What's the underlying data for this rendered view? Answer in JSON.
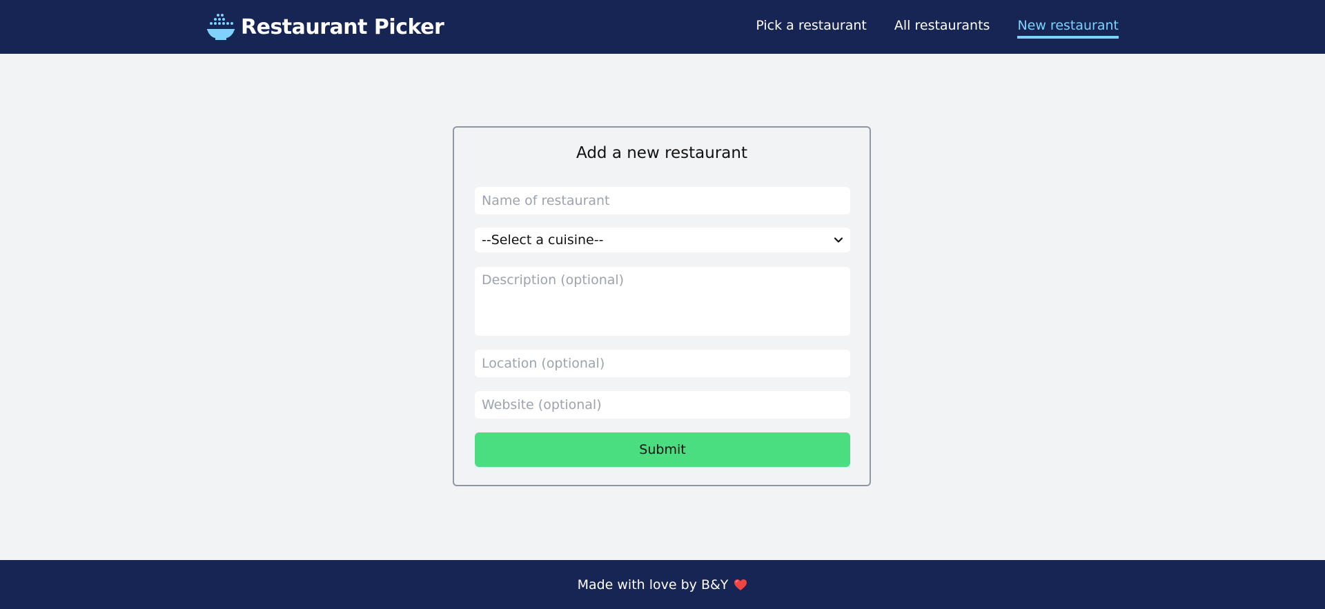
{
  "header": {
    "title": "Restaurant Picker",
    "logo_icon": "rice-bowl-icon",
    "nav": [
      {
        "label": "Pick a restaurant",
        "active": false
      },
      {
        "label": "All restaurants",
        "active": false
      },
      {
        "label": "New restaurant",
        "active": true
      }
    ]
  },
  "form": {
    "title": "Add a new restaurant",
    "name_placeholder": "Name of restaurant",
    "cuisine_selected": "--Select a cuisine--",
    "description_placeholder": "Description (optional)",
    "location_placeholder": "Location (optional)",
    "website_placeholder": "Website (optional)",
    "submit_label": "Submit"
  },
  "footer": {
    "text": "Made with love by B&Y",
    "icon": "heart-icon"
  },
  "colors": {
    "nav_bg": "#172554",
    "accent": "#7dd3fc",
    "submit_bg": "#4ade80",
    "page_bg": "#f2f3f5",
    "heart": "#ef4444"
  }
}
